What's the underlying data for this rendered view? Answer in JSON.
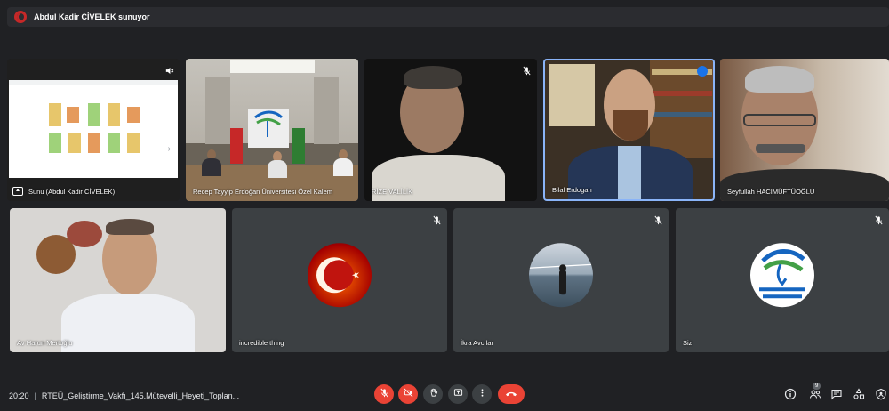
{
  "presenting_banner": {
    "text": "Abdul Kadir CİVELEK sunuyor"
  },
  "tiles": [
    {
      "id": "t1",
      "name": "Sunu (Abdul Kadir CİVELEK)"
    },
    {
      "id": "t2",
      "name": "Recep Tayyip Erdoğan Üniversitesi Özel Kalem"
    },
    {
      "id": "t3",
      "name": "RİZE VALİLİK"
    },
    {
      "id": "t4",
      "name": "Bilal Erdogan"
    },
    {
      "id": "t5",
      "name": "Seyfullah HACIMÜFTÜOĞLU"
    },
    {
      "id": "t6",
      "name": "Av Harun Mertoğlu"
    },
    {
      "id": "t7",
      "name": "incredible thing"
    },
    {
      "id": "t8",
      "name": "İkra Avcılar"
    },
    {
      "id": "t9",
      "name": "Siz"
    }
  ],
  "meeting": {
    "time": "20:20",
    "title": "RTEÜ_Geliştirme_Vakfı_145.Mütevelli_Heyeti_Toplan..."
  },
  "participants_count": "9",
  "colors": {
    "accent": "#8ab4f8",
    "danger": "#ea4335",
    "background": "#202124",
    "tile": "#3c4043"
  },
  "icons": {
    "mic": "mic-off-icon",
    "camera": "camera-off-icon",
    "hand": "raise-hand-icon",
    "present": "present-screen-icon",
    "more": "more-options-icon",
    "end": "end-call-icon",
    "info": "info-icon",
    "people": "people-icon",
    "chat": "chat-icon",
    "activities": "activities-icon",
    "security": "host-controls-icon"
  }
}
